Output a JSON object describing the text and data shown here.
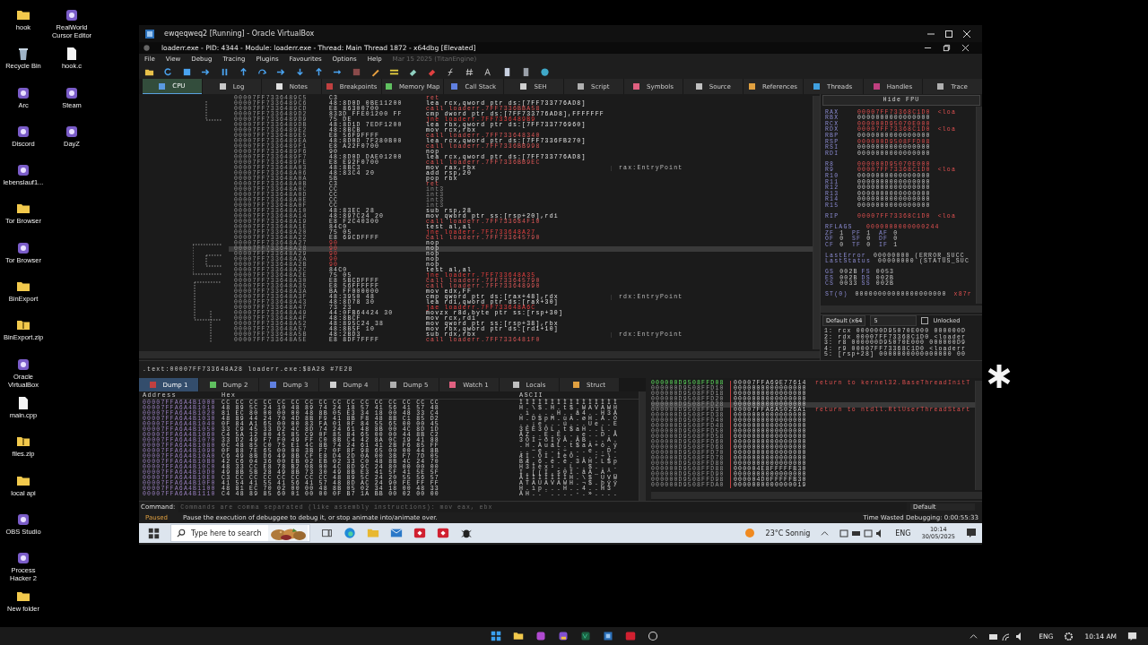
{
  "desktop_icons": [
    {
      "label": "hook",
      "kind": "folder"
    },
    {
      "label": "Recycle Bin",
      "kind": "bin"
    },
    {
      "label": "Arc",
      "kind": "app"
    },
    {
      "label": "Discord",
      "kind": "app"
    },
    {
      "label": "lebenslauf1...",
      "kind": "app"
    },
    {
      "label": "Tor Browser",
      "kind": "folder"
    },
    {
      "label": "Tor Browser",
      "kind": "app"
    },
    {
      "label": "BinExport",
      "kind": "folder"
    },
    {
      "label": "BinExport.zip",
      "kind": "zip"
    },
    {
      "label": "Oracle VirtualBox",
      "kind": "app"
    },
    {
      "label": "main.cpp",
      "kind": "file"
    },
    {
      "label": "files.zip",
      "kind": "zip"
    },
    {
      "label": "local api",
      "kind": "folder"
    },
    {
      "label": "OBS Studio",
      "kind": "app"
    },
    {
      "label": "Process Hacker 2",
      "kind": "app"
    },
    {
      "label": "New folder",
      "kind": "folder"
    },
    {
      "label": "RealWorld Cursor Editor",
      "kind": "app"
    },
    {
      "label": "hook.c",
      "kind": "file"
    },
    {
      "label": "Steam",
      "kind": "app"
    },
    {
      "label": "DayZ",
      "kind": "app"
    }
  ],
  "vm_window": {
    "title": "ewqeqweq2 [Running] - Oracle VirtualBox"
  },
  "debugger": {
    "title": "loaderr.exe - PID: 4344 - Module: loaderr.exe - Thread: Main Thread 1872 - x64dbg [Elevated]",
    "menu": [
      "File",
      "View",
      "Debug",
      "Tracing",
      "Plugins",
      "Favourites",
      "Options",
      "Help"
    ],
    "build_info": "Mar 15 2025 (TitanEngine)",
    "tabs": [
      {
        "label": "CPU",
        "selected": true
      },
      {
        "label": "Log",
        "selected": false
      },
      {
        "label": "Notes",
        "selected": false
      },
      {
        "label": "Breakpoints",
        "selected": false
      },
      {
        "label": "Memory Map",
        "selected": false
      },
      {
        "label": "Call Stack",
        "selected": false
      },
      {
        "label": "SEH",
        "selected": false
      },
      {
        "label": "Script",
        "selected": false
      },
      {
        "label": "Symbols",
        "selected": false
      },
      {
        "label": "Source",
        "selected": false
      },
      {
        "label": "References",
        "selected": false
      },
      {
        "label": "Threads",
        "selected": false
      },
      {
        "label": "Handles",
        "selected": false
      },
      {
        "label": "Trace",
        "selected": false
      }
    ],
    "disassembly": [
      {
        "address": "00007FF7336489C5",
        "bytes": "C3",
        "instruction": "ret",
        "kind": "ret",
        "patched": false,
        "selected": false
      },
      {
        "address": "00007FF7336489C6",
        "bytes": "48:8D0D 0BE11200",
        "instruction": "lea rcx,qword ptr ds:[7FF733776AD8]",
        "kind": "plain",
        "patched": false,
        "selected": false
      },
      {
        "address": "00007FF7336489CD",
        "bytes": "E8 86300700",
        "instruction": "call loaderr.7FF7336BBA58",
        "kind": "call",
        "patched": false,
        "selected": false
      },
      {
        "address": "00007FF7336489D2",
        "bytes": "833D FFE01200 FF",
        "instruction": "cmp dword ptr ds:[7FF733776AD8],FFFFFFF",
        "kind": "plain",
        "patched": false,
        "selected": false
      },
      {
        "address": "00007FF7336489D9",
        "bytes": "75 DE",
        "instruction": "jne loaderr.7FF7336489B9",
        "kind": "jump",
        "patched": false,
        "selected": false
      },
      {
        "address": "00007FF7336489DB",
        "bytes": "48:8D1D 7EDF1200",
        "instruction": "lea rbx,qword ptr ds:[7FF733776960]",
        "kind": "plain",
        "patched": false,
        "selected": false
      },
      {
        "address": "00007FF7336489E2",
        "bytes": "48:8BCB",
        "instruction": "mov rcx,rbx",
        "kind": "plain",
        "patched": false,
        "selected": false
      },
      {
        "address": "00007FF7336489E5",
        "bytes": "E8 56F9FFFF",
        "instruction": "call loaderr.7FF733648340",
        "kind": "call",
        "patched": false,
        "selected": false
      },
      {
        "address": "00007FF7336489EA",
        "bytes": "48:8D0D 7F280B00",
        "instruction": "lea rcx,qword ptr ds:[7FF7336FB270]",
        "kind": "plain",
        "patched": false,
        "selected": false
      },
      {
        "address": "00007FF7336489F1",
        "bytes": "E8 A22F0700",
        "instruction": "call loaderr.7FF7336BB998",
        "kind": "call",
        "patched": false,
        "selected": false
      },
      {
        "address": "00007FF7336489F6",
        "bytes": "90",
        "instruction": "nop",
        "kind": "plain",
        "patched": false,
        "selected": false
      },
      {
        "address": "00007FF7336489F7",
        "bytes": "48:8D0D DAE01200",
        "instruction": "lea rcx,qword ptr ds:[7FF733776AD8]",
        "kind": "plain",
        "patched": false,
        "selected": false
      },
      {
        "address": "00007FF7336489FE",
        "bytes": "E8 E92F0700",
        "instruction": "call loaderr.7FF7336BB9EC",
        "kind": "call",
        "patched": false,
        "selected": false
      },
      {
        "address": "00007FF733648A03",
        "bytes": "48:8BC3",
        "instruction": "mov rax,rbx",
        "kind": "plain",
        "patched": false,
        "selected": false,
        "comment": "rax:EntryPoint"
      },
      {
        "address": "00007FF733648A06",
        "bytes": "48:83C4 20",
        "instruction": "add rsp,20",
        "kind": "plain",
        "patched": false,
        "selected": false
      },
      {
        "address": "00007FF733648A0A",
        "bytes": "5B",
        "instruction": "pop rbx",
        "kind": "plain",
        "patched": false,
        "selected": false
      },
      {
        "address": "00007FF733648A0B",
        "bytes": "C3",
        "instruction": "ret",
        "kind": "ret",
        "patched": false,
        "selected": false
      },
      {
        "address": "00007FF733648A0C",
        "bytes": "CC",
        "instruction": "int3",
        "kind": "int3",
        "patched": false,
        "selected": false
      },
      {
        "address": "00007FF733648A0D",
        "bytes": "CC",
        "instruction": "int3",
        "kind": "int3",
        "patched": false,
        "selected": false
      },
      {
        "address": "00007FF733648A0E",
        "bytes": "CC",
        "instruction": "int3",
        "kind": "int3",
        "patched": false,
        "selected": false
      },
      {
        "address": "00007FF733648A0F",
        "bytes": "CC",
        "instruction": "int3",
        "kind": "int3",
        "patched": false,
        "selected": false
      },
      {
        "address": "00007FF733648A10",
        "bytes": "48:83EC 28",
        "instruction": "sub rsp,28",
        "kind": "plain",
        "patched": false,
        "selected": false
      },
      {
        "address": "00007FF733648A14",
        "bytes": "48:897C24 20",
        "instruction": "mov qword ptr ss:[rsp+20],rdi",
        "kind": "plain",
        "patched": false,
        "selected": false
      },
      {
        "address": "00007FF733648A19",
        "bytes": "E8 F2C40300",
        "instruction": "call loaderr.7FF733684F10",
        "kind": "call",
        "patched": false,
        "selected": false
      },
      {
        "address": "00007FF733648A1E",
        "bytes": "84C0",
        "instruction": "test al,al",
        "kind": "plain",
        "patched": false,
        "selected": false
      },
      {
        "address": "00007FF733648A20",
        "bytes": "75 05",
        "instruction": "jne loaderr.7FF733648A27",
        "kind": "jump",
        "patched": false,
        "selected": false
      },
      {
        "address": "00007FF733648A22",
        "bytes": "E8 69CDFFFF",
        "instruction": "call loaderr.7FF733645790",
        "kind": "call",
        "patched": false,
        "selected": false
      },
      {
        "address": "00007FF733648A27",
        "bytes": "90",
        "instruction": "nop",
        "kind": "plain",
        "patched": true,
        "selected": false
      },
      {
        "address": "00007FF733648A28",
        "bytes": "90",
        "instruction": "nop",
        "kind": "plain",
        "patched": true,
        "selected": true
      },
      {
        "address": "00007FF733648A29",
        "bytes": "90",
        "instruction": "nop",
        "kind": "plain",
        "patched": true,
        "selected": false
      },
      {
        "address": "00007FF733648A2A",
        "bytes": "90",
        "instruction": "nop",
        "kind": "plain",
        "patched": true,
        "selected": false
      },
      {
        "address": "00007FF733648A2B",
        "bytes": "90",
        "instruction": "nop",
        "kind": "plain",
        "patched": true,
        "selected": false
      },
      {
        "address": "00007FF733648A2C",
        "bytes": "84C0",
        "instruction": "test al,al",
        "kind": "plain",
        "patched": false,
        "selected": false
      },
      {
        "address": "00007FF733648A2E",
        "bytes": "75 05",
        "instruction": "jne loaderr.7FF733648A35",
        "kind": "jump",
        "patched": false,
        "selected": false
      },
      {
        "address": "00007FF733648A30",
        "bytes": "E8 5BCDFFFF",
        "instruction": "call loaderr.7FF733645790",
        "kind": "call",
        "patched": false,
        "selected": false
      },
      {
        "address": "00007FF733648A35",
        "bytes": "E8 56FFFFFF",
        "instruction": "call loaderr.7FF733648990",
        "kind": "call",
        "patched": false,
        "selected": false
      },
      {
        "address": "00007FF733648A3A",
        "bytes": "BA FF000000",
        "instruction": "mov edx,FF",
        "kind": "plain",
        "patched": false,
        "selected": false
      },
      {
        "address": "00007FF733648A3F",
        "bytes": "48:3950 48",
        "instruction": "cmp qword ptr ds:[rax+48],rdx",
        "kind": "plain",
        "patched": false,
        "selected": false,
        "comment": "rdx:EntryPoint"
      },
      {
        "address": "00007FF733648A43",
        "bytes": "48:8D78 30",
        "instruction": "lea rdi,qword ptr ds:[rax+30]",
        "kind": "plain",
        "patched": false,
        "selected": false
      },
      {
        "address": "00007FF733648A47",
        "bytes": "73 23",
        "instruction": "jae loaderr.7FF733648A6C",
        "kind": "jump",
        "patched": false,
        "selected": false
      },
      {
        "address": "00007FF733648A49",
        "bytes": "44:0FB64424 30",
        "instruction": "movzx r8d,byte ptr ss:[rsp+30]",
        "kind": "plain",
        "patched": false,
        "selected": false
      },
      {
        "address": "00007FF733648A4F",
        "bytes": "48:8BCF",
        "instruction": "mov rcx,rdi",
        "kind": "plain",
        "patched": false,
        "selected": false
      },
      {
        "address": "00007FF733648A52",
        "bytes": "48:895C24 38",
        "instruction": "mov qword ptr ss:[rsp+38],rbx",
        "kind": "plain",
        "patched": false,
        "selected": false
      },
      {
        "address": "00007FF733648A57",
        "bytes": "48:8B5F 10",
        "instruction": "mov rbx,qword ptr ds:[rdi+10]",
        "kind": "plain",
        "patched": false,
        "selected": false
      },
      {
        "address": "00007FF733648A5B",
        "bytes": "48:2BD3",
        "instruction": "sub rdx,rbx",
        "kind": "plain",
        "patched": false,
        "selected": false,
        "comment": "rdx:EntryPoint"
      },
      {
        "address": "00007FF733648A5E",
        "bytes": "E8 8DF7FFFF",
        "instruction": "call loaderr.7FF7336481F0",
        "kind": "call",
        "patched": false,
        "selected": false
      }
    ],
    "fpu_button": "Hide FPU",
    "register_groups": [
      [
        {
          "name": "RAX",
          "value": "00007FF73368C1D0",
          "changed": true,
          "comment": "<loa"
        },
        {
          "name": "RBX",
          "value": "0000000000000000",
          "changed": false
        },
        {
          "name": "RCX",
          "value": "000000D95070E000",
          "changed": true
        },
        {
          "name": "RDX",
          "value": "00007FF73368C1D0",
          "changed": true,
          "comment": "<loa"
        },
        {
          "name": "RBP",
          "value": "0000000000000000",
          "changed": false
        },
        {
          "name": "RSP",
          "value": "000000D9508FFD08",
          "changed": true
        },
        {
          "name": "RSI",
          "value": "0000000000000000",
          "changed": false
        },
        {
          "name": "RDI",
          "value": "0000000000000000",
          "changed": false
        }
      ],
      [
        {
          "name": "R8",
          "value": "000000D95070E000",
          "changed": true
        },
        {
          "name": "R9",
          "value": "00007FF73368C1D0",
          "changed": true,
          "comment": "<loa"
        },
        {
          "name": "R10",
          "value": "0000000000000000",
          "changed": false
        },
        {
          "name": "R11",
          "value": "0000000000000000",
          "changed": false
        },
        {
          "name": "R12",
          "value": "0000000000000000",
          "changed": false
        },
        {
          "name": "R13",
          "value": "0000000000000000",
          "changed": false
        },
        {
          "name": "R14",
          "value": "0000000000000000",
          "changed": false
        },
        {
          "name": "R15",
          "value": "0000000000000000",
          "changed": false
        }
      ],
      [
        {
          "name": "RIP",
          "value": "00007FF73368C1D0",
          "changed": true,
          "comment": "<loa"
        }
      ]
    ],
    "rflags": {
      "name": "RFLAGS",
      "value": "0000000000000244",
      "changed": true
    },
    "flags": [
      {
        "name": "ZF",
        "value": "1"
      },
      {
        "name": "PF",
        "value": "1"
      },
      {
        "name": "AF",
        "value": "0"
      },
      {
        "name": "OF",
        "value": "0"
      },
      {
        "name": "SF",
        "value": "0"
      },
      {
        "name": "DF",
        "value": "0"
      },
      {
        "name": "CF",
        "value": "0"
      },
      {
        "name": "TF",
        "value": "0"
      },
      {
        "name": "IF",
        "value": "1"
      }
    ],
    "errors": [
      {
        "name": "LastError",
        "value": "00000000 (ERROR_SUCC"
      },
      {
        "name": "LastStatus",
        "value": "00000000 (STATUS_SUC"
      }
    ],
    "segments": [
      {
        "name": "GS",
        "value": "002B"
      },
      {
        "name": "FS",
        "value": "0053"
      },
      {
        "name": "ES",
        "value": "002B"
      },
      {
        "name": "DS",
        "value": "002B"
      },
      {
        "name": "CS",
        "value": "0033"
      },
      {
        "name": "SS",
        "value": "002B"
      }
    ],
    "fpu": [
      {
        "name": "ST(0)",
        "value": "00000000000000000000",
        "comment": "x87r"
      }
    ],
    "args": {
      "convention": "Default (x64",
      "count": "5",
      "unlocked_label": "Unlocked",
      "unlocked": false,
      "rows": [
        "1: rcx 000000D95070E000 000000D",
        "2: rdx 00007FF73368C1D0 <loader",
        "3: r8 000000D95070E000 000000D9",
        "4: r9 00007FF73368C1D0 <loaderr",
        "5: [rsp+28] 0000000000000000 00"
      ]
    },
    "info_line": ".text:00007FF733648A28 loaderr.exe:$8A28 #7E28",
    "dump_tabs": [
      {
        "label": "Dump 1",
        "selected": true
      },
      {
        "label": "Dump 2",
        "selected": false
      },
      {
        "label": "Dump 3",
        "selected": false
      },
      {
        "label": "Dump 4",
        "selected": false
      },
      {
        "label": "Dump 5",
        "selected": false
      },
      {
        "label": "Watch 1",
        "selected": false
      },
      {
        "label": "Locals",
        "selected": false
      },
      {
        "label": "Struct",
        "selected": false
      }
    ],
    "dump_columns": [
      "Address",
      "Hex",
      "ASCII"
    ],
    "dump": [
      {
        "address": "00007FFA6A4B1000",
        "hex": "CC CC CC CC CC CC CC CC CC CC CC CC CC CC CC CC",
        "ascii": "ÌÌÌÌÌÌÌÌÌÌÌÌÌÌÌÌ"
      },
      {
        "address": "00007FFA6A4B1010",
        "hex": "48 89 5C 24 10 48 89 74 24 18 57 41 56 41 57 48",
        "ascii": "H.\\$.H.t$.WAVAWH"
      },
      {
        "address": "00007FFA6A4B1020",
        "hex": "81 EC 80 00 00 00 48 8B 05 E3 34 18 00 48 33 C4",
        "ascii": ".ì....H..ã4..H3Ä"
      },
      {
        "address": "00007FFA6A4B1030",
        "hex": "48 89 44 24 70 4D 8B F9 41 8B F8 48 8B C1 85 D2",
        "ascii": "H.D$pM.ùA.øH.Á.Ò"
      },
      {
        "address": "00007FFA6A4B1040",
        "hex": "0F 84 A1 65 00 00 83 FA 01 0F 84 55 65 00 00 45",
        "ascii": "..¡e...ú...Ue..E"
      },
      {
        "address": "00007FFA6A4B1050",
        "hex": "33 C9 45 33 D2 4C 8D 74 24 61 48 8B 00 4C 8D 1D",
        "ascii": "3ÉE3ÒL.t$aH..L.."
      },
      {
        "address": "00007FFA6A4B1060",
        "hex": "C4 5A 12 00 45 85 C9 0F 85 84 65 00 00 44 8B C2",
        "ascii": "ÄZ..E.É...e..D.Â"
      },
      {
        "address": "00007FFA6A4B1070",
        "hex": "33 D2 49 F7 F0 49 FF C0 8B C4 42 8A 0C 19 41 88",
        "ascii": "3ÒI÷ðIÿÀ.ÄB...A."
      },
      {
        "address": "00007FFA6A4B1080",
        "hex": "0C 48 85 C0 75 E1 4C 8B 74 24 61 41 2B F6 85 FF",
        "ascii": ".H.ÀuáL.t$aA+ö.ÿ"
      },
      {
        "address": "00007FFA6A4B1090",
        "hex": "0F 88 7E 65 00 00 3B F7 0F 8F 98 65 00 00 44 8B",
        "ascii": "..~e..;÷...e..D."
      },
      {
        "address": "00007FFA6A4B10A0",
        "hex": "C6 49 8B D6 49 8B CF E8 D4 2D 0A 00 3B F7 7D 05",
        "ascii": "ÆI.ÖI.ÏèÔ-..;÷}."
      },
      {
        "address": "00007FFA6A4B10B0",
        "hex": "42 C6 04 36 00 EB 02 EB 02 33 C0 48 8B 4C 24 70",
        "ascii": "BÆ.6.ë.ë.3ÀH.L$p"
      },
      {
        "address": "00007FFA6A4B10C0",
        "hex": "48 33 CC E8 78 B2 08 00 4C 8D 9C 24 80 00 00 00",
        "ascii": "H3Ìèx²..L..$...."
      },
      {
        "address": "00007FFA6A4B10D0",
        "hex": "49 8B 5B 28 49 8B 73 30 49 8B E3 41 5F 41 5E 5F",
        "ascii": "I.[(I.s0I.ãA_A^_"
      },
      {
        "address": "00007FFA6A4B10E0",
        "hex": "C3 CC CC CC CC CC CC CC 48 89 5C 24 20 55 56 57",
        "ascii": "ÃÌÌÌÌÌÌÌH.\\$ UVW"
      },
      {
        "address": "00007FFA6A4B10F0",
        "hex": "41 54 41 55 41 56 41 57 48 8D AC 24 90 FE FF FF",
        "ascii": "ATAUAVAWH.¬$.þÿÿ"
      },
      {
        "address": "00007FFA6A4B1100",
        "hex": "48 81 EC 70 02 00 00 48 8B 05 02 34 18 00 48 33",
        "ascii": "H.ìp...H..4..H3"
      },
      {
        "address": "00007FFA6A4B1110",
        "hex": "C4 48 89 85 60 01 00 00 0F B7 1A BB 00 02 00 00",
        "ascii": "ÄH..`....·.»...."
      }
    ],
    "stack": [
      {
        "address": "000000D9508FFD08",
        "value": "00007FFA69E77614",
        "comment": "return to kernel32.BaseThreadInitT",
        "current": true,
        "selected": false
      },
      {
        "address": "000000D9508FFD10",
        "value": "0000000000000000",
        "current": false,
        "selected": false
      },
      {
        "address": "000000D9508FFD18",
        "value": "0000000000000000",
        "current": false,
        "selected": false
      },
      {
        "address": "000000D9508FFD20",
        "value": "0000000000000000",
        "current": false,
        "selected": false
      },
      {
        "address": "000000D9508FFD28",
        "value": "0000000000000000",
        "current": false,
        "selected": true
      },
      {
        "address": "000000D9508FFD30",
        "value": "00007FFA6A5026A1",
        "comment": "return to ntdll.RtlUserThreadStart",
        "current": false,
        "selected": false
      },
      {
        "address": "000000D9508FFD38",
        "value": "0000000000000000",
        "current": false,
        "selected": false
      },
      {
        "address": "000000D9508FFD40",
        "value": "0000000000000000",
        "current": false,
        "selected": false
      },
      {
        "address": "000000D9508FFD48",
        "value": "0000000000000000",
        "current": false,
        "selected": false
      },
      {
        "address": "000000D9508FFD50",
        "value": "0000000000000000",
        "current": false,
        "selected": false
      },
      {
        "address": "000000D9508FFD58",
        "value": "0000000000000000",
        "current": false,
        "selected": false
      },
      {
        "address": "000000D9508FFD60",
        "value": "0000000000000000",
        "current": false,
        "selected": false
      },
      {
        "address": "000000D9508FFD68",
        "value": "0000000000000000",
        "current": false,
        "selected": false
      },
      {
        "address": "000000D9508FFD70",
        "value": "0000000000000000",
        "current": false,
        "selected": false
      },
      {
        "address": "000000D9508FFD78",
        "value": "0000000000000000",
        "current": false,
        "selected": false
      },
      {
        "address": "000000D9508FFD80",
        "value": "0000000000000000",
        "current": false,
        "selected": false
      },
      {
        "address": "000000D9508FFD88",
        "value": "000004E8FFFFFB30",
        "current": false,
        "selected": false
      },
      {
        "address": "000000D9508FFD90",
        "value": "0000000000000000",
        "current": false,
        "selected": false
      },
      {
        "address": "000000D9508FFD98",
        "value": "000004D0FFFFFB30",
        "current": false,
        "selected": false
      },
      {
        "address": "000000D9508FFDA0",
        "value": "0000000000000019",
        "current": false,
        "selected": false
      }
    ],
    "command": {
      "label": "Command:",
      "placeholder": "Commands are comma separated (like assembly instructions): mov eax, ebx"
    },
    "command_mode": "Default",
    "status": {
      "state": "Paused",
      "message": "Pause the execution of debuggee to debug it, or stop animate into/animate over.",
      "time": "Time Wasted Debugging: 0:00:55:33"
    }
  },
  "guest_taskbar": {
    "search_placeholder": "Type here to search",
    "weather": "23°C Sonnig",
    "language": "ENG",
    "time": "10:14",
    "date": "30/05/2025"
  },
  "host_taskbar": {
    "language": "ENG",
    "time": "10:14 AM"
  }
}
